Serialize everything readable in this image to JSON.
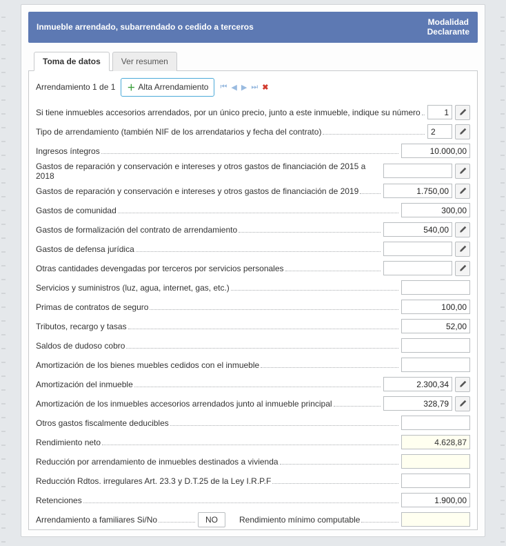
{
  "header": {
    "title": "Inmueble arrendado, subarrendado o cedido a terceros",
    "modalidad": "Modalidad",
    "declarante": "Declarante"
  },
  "tabs": {
    "toma": "Toma de datos",
    "resumen": "Ver resumen"
  },
  "counter": "Arrendamiento 1 de 1",
  "alta": "Alta Arrendamiento",
  "rows": [
    {
      "label": "Si tiene inmuebles accesorios arrendados, por un único precio, junto a este inmueble, indique su número",
      "value": "1",
      "edit": true,
      "small": true
    },
    {
      "label": "Tipo de arrendamiento (también NIF de los arrendatarios y fecha del contrato)",
      "value": "2",
      "edit": true,
      "small": true,
      "leftAlign": true
    },
    {
      "label": "Ingresos íntegros",
      "value": "10.000,00",
      "edit": false
    },
    {
      "label": "Gastos de reparación y conservación e intereses y otros gastos de financiación de 2015 a 2018",
      "value": "",
      "edit": true
    },
    {
      "label": "Gastos de reparación y conservación e intereses y otros gastos de financiación de 2019",
      "value": "1.750,00",
      "edit": true
    },
    {
      "label": "Gastos de comunidad",
      "value": "300,00",
      "edit": false
    },
    {
      "label": "Gastos de formalización del contrato de arrendamiento",
      "value": "540,00",
      "edit": true
    },
    {
      "label": "Gastos de defensa jurídica",
      "value": "",
      "edit": true
    },
    {
      "label": "Otras cantidades devengadas por terceros por servicios personales",
      "value": "",
      "edit": true
    },
    {
      "label": "Servicios y suministros (luz, agua, internet, gas, etc.)",
      "value": "",
      "edit": false
    },
    {
      "label": "Primas de contratos de seguro",
      "value": "100,00",
      "edit": false
    },
    {
      "label": "Tributos, recargo y tasas",
      "value": "52,00",
      "edit": false
    },
    {
      "label": "Saldos de dudoso cobro",
      "value": "",
      "edit": false
    },
    {
      "label": "Amortización de los bienes muebles cedidos con el inmueble",
      "value": "",
      "edit": false
    },
    {
      "label": "Amortización del inmueble",
      "value": "2.300,34",
      "edit": true
    },
    {
      "label": "Amortización de los inmuebles accesorios arrendados junto al inmueble principal",
      "value": "328,79",
      "edit": true
    },
    {
      "label": "Otros gastos fiscalmente deducibles",
      "value": "",
      "edit": false
    },
    {
      "label": "Rendimiento neto",
      "value": "4.628,87",
      "edit": false,
      "readonly": true
    },
    {
      "label": "Reducción por arrendamiento de inmuebles destinados a vivienda",
      "value": "",
      "edit": false,
      "readonly": true
    },
    {
      "label": "Reducción Rdtos. irregulares Art. 23.3 y D.T.25 de la Ley I.R.P.F",
      "value": "",
      "edit": false
    },
    {
      "label": "Retenciones",
      "value": "1.900,00",
      "edit": false
    }
  ],
  "familiar": {
    "label": "Arrendamiento a familiares Si/No",
    "value": "NO",
    "label2": "Rendimiento mínimo computable",
    "value2": ""
  }
}
